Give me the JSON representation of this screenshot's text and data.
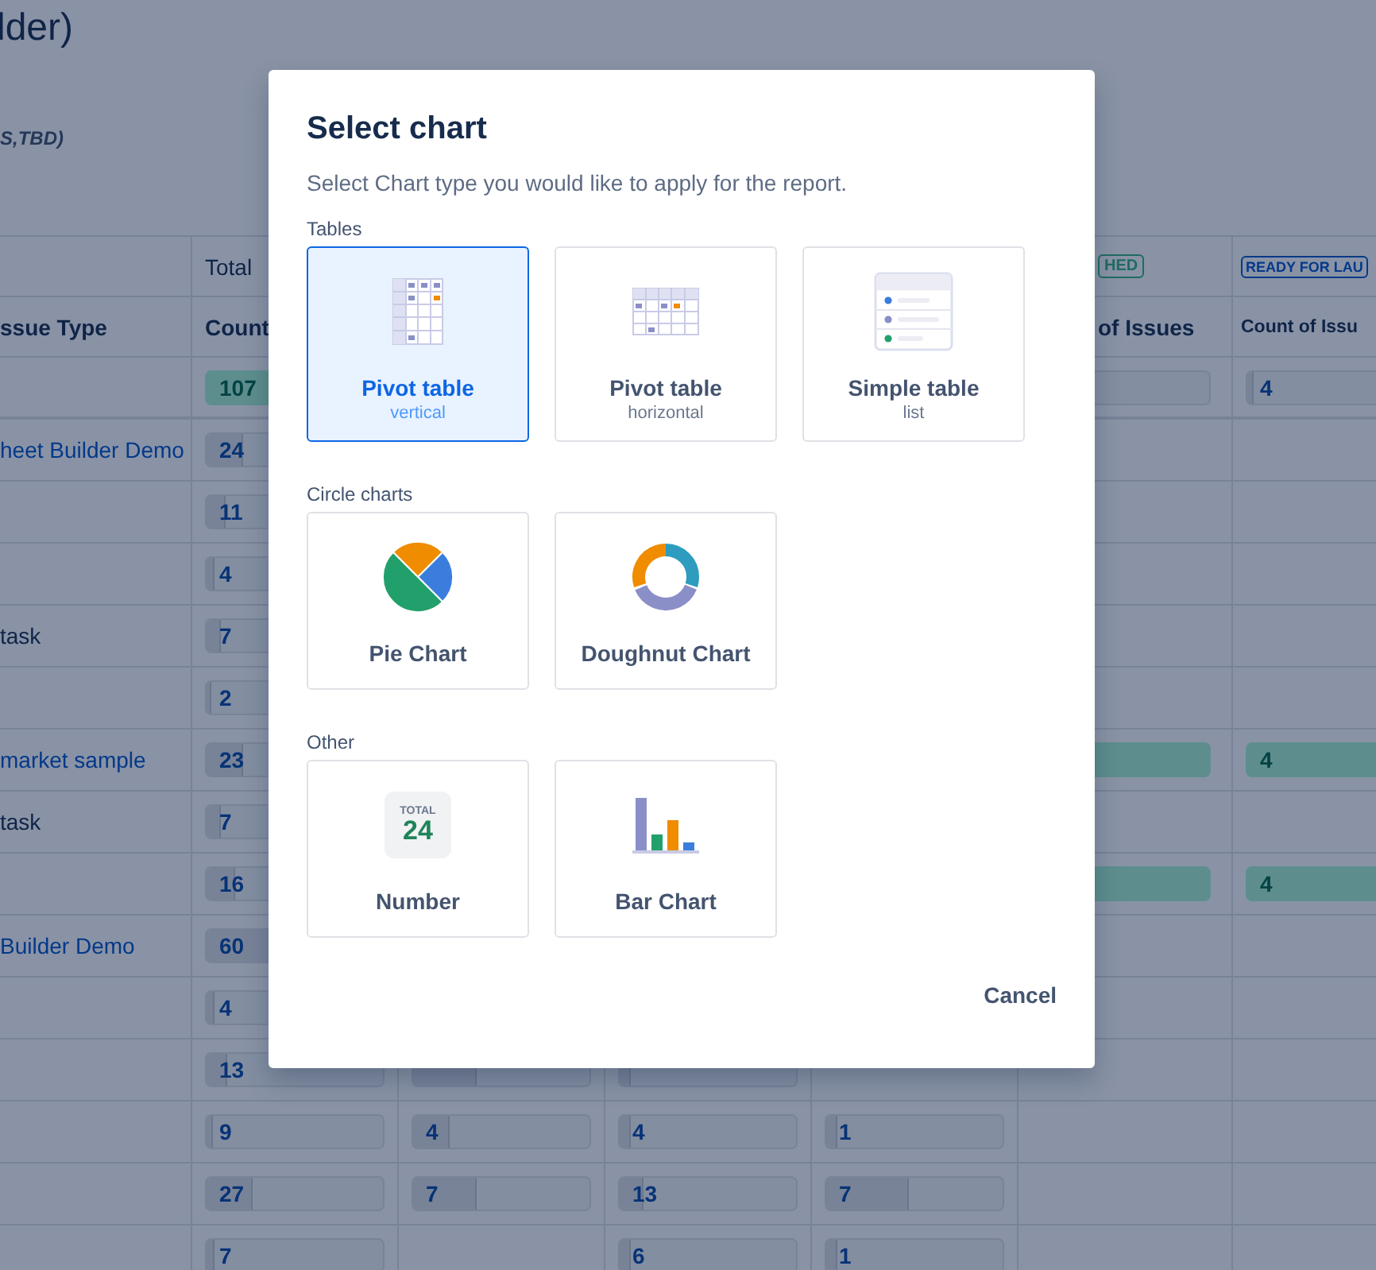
{
  "page": {
    "title": "lder)",
    "subtitle": "S,TBD)"
  },
  "table": {
    "group_headers": [
      {
        "kind": "blank"
      },
      {
        "kind": "text",
        "label": "Total"
      },
      {
        "kind": "blank"
      },
      {
        "kind": "blank"
      },
      {
        "kind": "blank"
      },
      {
        "kind": "badge",
        "label": "HED",
        "color": "#206b61"
      },
      {
        "kind": "badge",
        "label": "READY FOR LAU",
        "color": "#04398a"
      }
    ],
    "columns": [
      "ssue Type",
      "Count",
      "",
      "",
      "",
      "of Issues",
      "Count of Issu"
    ],
    "rows": [
      {
        "cells": [
          "",
          {
            "value": "107",
            "level": 1,
            "highlight": true
          },
          "",
          "",
          "",
          {
            "level": 0.02,
            "highlight": false
          },
          {
            "value": "4",
            "level": 0.03,
            "highlight": false
          }
        ]
      },
      {
        "cells": [
          {
            "text": "heet Builder Demo",
            "link": true
          },
          {
            "value": "24",
            "level": 0.2,
            "highlight": false
          },
          "",
          "",
          "",
          "",
          ""
        ]
      },
      {
        "cells": [
          "",
          {
            "value": "11",
            "level": 0.1,
            "highlight": false
          },
          "",
          "",
          "",
          "",
          ""
        ]
      },
      {
        "cells": [
          "",
          {
            "value": "4",
            "level": 0.04,
            "highlight": false
          },
          "",
          "",
          "",
          "",
          ""
        ]
      },
      {
        "cells": [
          {
            "text": "task",
            "link": false
          },
          {
            "value": "7",
            "level": 0.07,
            "highlight": false
          },
          "",
          "",
          "",
          "",
          ""
        ]
      },
      {
        "cells": [
          "",
          {
            "value": "2",
            "level": 0.02,
            "highlight": false
          },
          "",
          "",
          "",
          "",
          ""
        ]
      },
      {
        "cells": [
          {
            "text": "market sample",
            "link": true
          },
          {
            "value": "23",
            "level": 0.2,
            "highlight": false
          },
          "",
          "",
          "",
          {
            "level": 1,
            "highlight": true
          },
          {
            "value": "4",
            "level": 1,
            "highlight": true
          }
        ]
      },
      {
        "cells": [
          {
            "text": "task",
            "link": false
          },
          {
            "value": "7",
            "level": 0.07,
            "highlight": false
          },
          "",
          "",
          "",
          "",
          ""
        ]
      },
      {
        "cells": [
          "",
          {
            "value": "16",
            "level": 0.15,
            "highlight": false
          },
          "",
          "",
          "",
          {
            "level": 1,
            "highlight": true
          },
          {
            "value": "4",
            "level": 1,
            "highlight": true
          }
        ]
      },
      {
        "cells": [
          {
            "text": "Builder Demo",
            "link": true
          },
          {
            "value": "60",
            "level": 0.55,
            "highlight": false
          },
          "",
          "",
          "",
          "",
          ""
        ]
      },
      {
        "cells": [
          "",
          {
            "value": "4",
            "level": 0.04,
            "highlight": false
          },
          "",
          "",
          "",
          "",
          ""
        ]
      },
      {
        "cells": [
          "",
          {
            "value": "13",
            "level": 0.11,
            "highlight": false
          },
          {
            "level": 0.35,
            "highlight": false
          },
          {
            "level": 0.05,
            "highlight": false
          },
          "",
          "",
          ""
        ]
      },
      {
        "cells": [
          "",
          {
            "value": "9",
            "level": 0.03,
            "highlight": false
          },
          {
            "value": "4",
            "level": 0.2,
            "highlight": false
          },
          {
            "value": "4",
            "level": 0.05,
            "highlight": false
          },
          {
            "value": "1",
            "level": 0.05,
            "highlight": false
          },
          "",
          ""
        ]
      },
      {
        "cells": [
          "",
          {
            "value": "27",
            "level": 0.25,
            "highlight": false
          },
          {
            "value": "7",
            "level": 0.35,
            "highlight": false
          },
          {
            "value": "13",
            "level": 0.13,
            "highlight": false
          },
          {
            "value": "7",
            "level": 0.46,
            "highlight": false
          },
          "",
          ""
        ]
      },
      {
        "cells": [
          "",
          {
            "value": "7",
            "level": 0.04,
            "highlight": false
          },
          "",
          {
            "value": "6",
            "level": 0.05,
            "highlight": false
          },
          {
            "value": "1",
            "level": 0.05,
            "highlight": false
          },
          "",
          ""
        ]
      }
    ]
  },
  "dialog": {
    "title": "Select chart",
    "description": "Select Chart type you would like to apply for the report.",
    "sections": [
      {
        "title": "Tables",
        "charts": [
          {
            "kind": "pivot-vertical",
            "title": "Pivot table",
            "subtitle": "vertical",
            "selected": true
          },
          {
            "kind": "pivot-horizontal",
            "title": "Pivot table",
            "subtitle": "horizontal",
            "selected": false
          },
          {
            "kind": "simple-table",
            "title": "Simple table",
            "subtitle": "list",
            "selected": false
          }
        ]
      },
      {
        "title": "Circle charts",
        "charts": [
          {
            "kind": "pie",
            "title": "Pie Chart",
            "selected": false
          },
          {
            "kind": "doughnut",
            "title": "Doughnut Chart",
            "selected": false
          }
        ]
      },
      {
        "title": "Other",
        "charts": [
          {
            "kind": "number",
            "title": "Number",
            "total_label": "TOTAL",
            "total_value": "24",
            "selected": false
          },
          {
            "kind": "bar",
            "title": "Bar Chart",
            "selected": false
          }
        ]
      }
    ],
    "cancel": "Cancel"
  }
}
